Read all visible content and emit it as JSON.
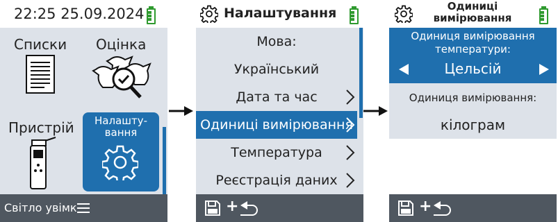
{
  "screen1": {
    "datetime": "22:25 25.09.2024",
    "tiles": {
      "lists": "Списки",
      "assessment": "Оцінка",
      "device": "Пристрій",
      "settings_line1": "Налашту-",
      "settings_line2": "вання"
    },
    "footer": {
      "light_label": "Світло увімк"
    }
  },
  "screen2": {
    "title": "Налаштування",
    "items": [
      {
        "label": "Мова:"
      },
      {
        "label": "Український"
      },
      {
        "label": "Дата та час"
      },
      {
        "label": "Одиниці вимірювання"
      },
      {
        "label": "Температура"
      },
      {
        "label": "Реєстрація даних"
      }
    ],
    "footer_symbol": "+"
  },
  "screen3": {
    "title_line1": "Одиниці",
    "title_line2": "вимірювання",
    "temp_label_line1": "Одиниця вимірювання",
    "temp_label_line2": "температури:",
    "temp_value": "Цельсій",
    "weight_label": "Одиниця вимірювання:",
    "weight_value": "кілограм",
    "footer_symbol": "+"
  },
  "colors": {
    "accent": "#1f6fae",
    "panel": "#dde2e9",
    "footer": "#4f5760",
    "battery": "#2f9a2f"
  },
  "icons": [
    "battery-icon",
    "document-icon",
    "cows-magnifier-icon",
    "handheld-device-icon",
    "gear-icon",
    "menu-icon",
    "save-icon",
    "return-icon",
    "chevron-right-icon",
    "arrow-left-icon",
    "arrow-right-icon",
    "flow-arrow-icon"
  ]
}
